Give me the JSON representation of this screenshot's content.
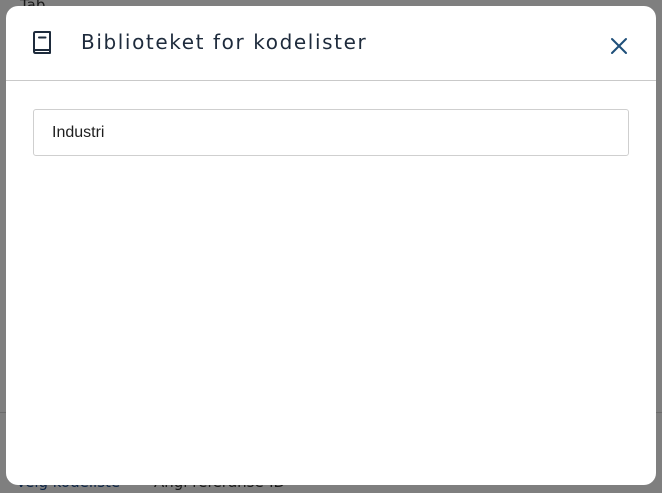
{
  "background": {
    "top_text": "Tab",
    "bottom_link": "Velg kodeliste",
    "bottom_text": "Angi referanse-ID"
  },
  "modal": {
    "title": "Biblioteket for kodelister",
    "search_value": "Industri"
  },
  "colors": {
    "title": "#1e2b3c",
    "close_icon": "#1f4f7a",
    "border": "#c9c9c9"
  },
  "icons": {
    "header": "book-icon",
    "close": "close-icon"
  }
}
